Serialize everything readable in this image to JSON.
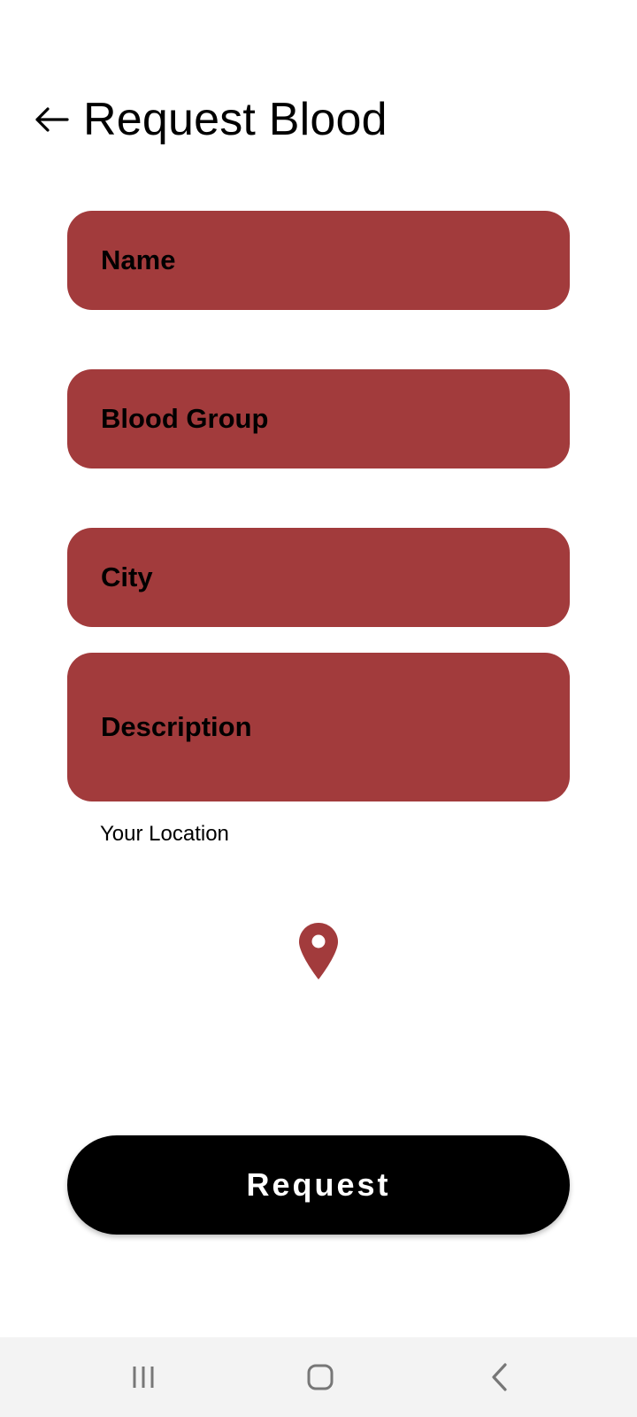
{
  "header": {
    "title": "Request Blood",
    "back_icon": "arrow-left-icon"
  },
  "form": {
    "name_placeholder": "Name",
    "blood_group_placeholder": "Blood Group",
    "city_placeholder": "City",
    "description_placeholder": "Description",
    "field_color": "#a23b3c"
  },
  "location": {
    "label": "Your Location",
    "icon": "location-pin-icon"
  },
  "request_button": {
    "label": "Request",
    "color": "#000000"
  },
  "system_nav": {
    "recents_icon": "recents-icon",
    "home_icon": "home-icon",
    "back_icon": "back-chevron-icon",
    "background": "#f3f3f3"
  }
}
